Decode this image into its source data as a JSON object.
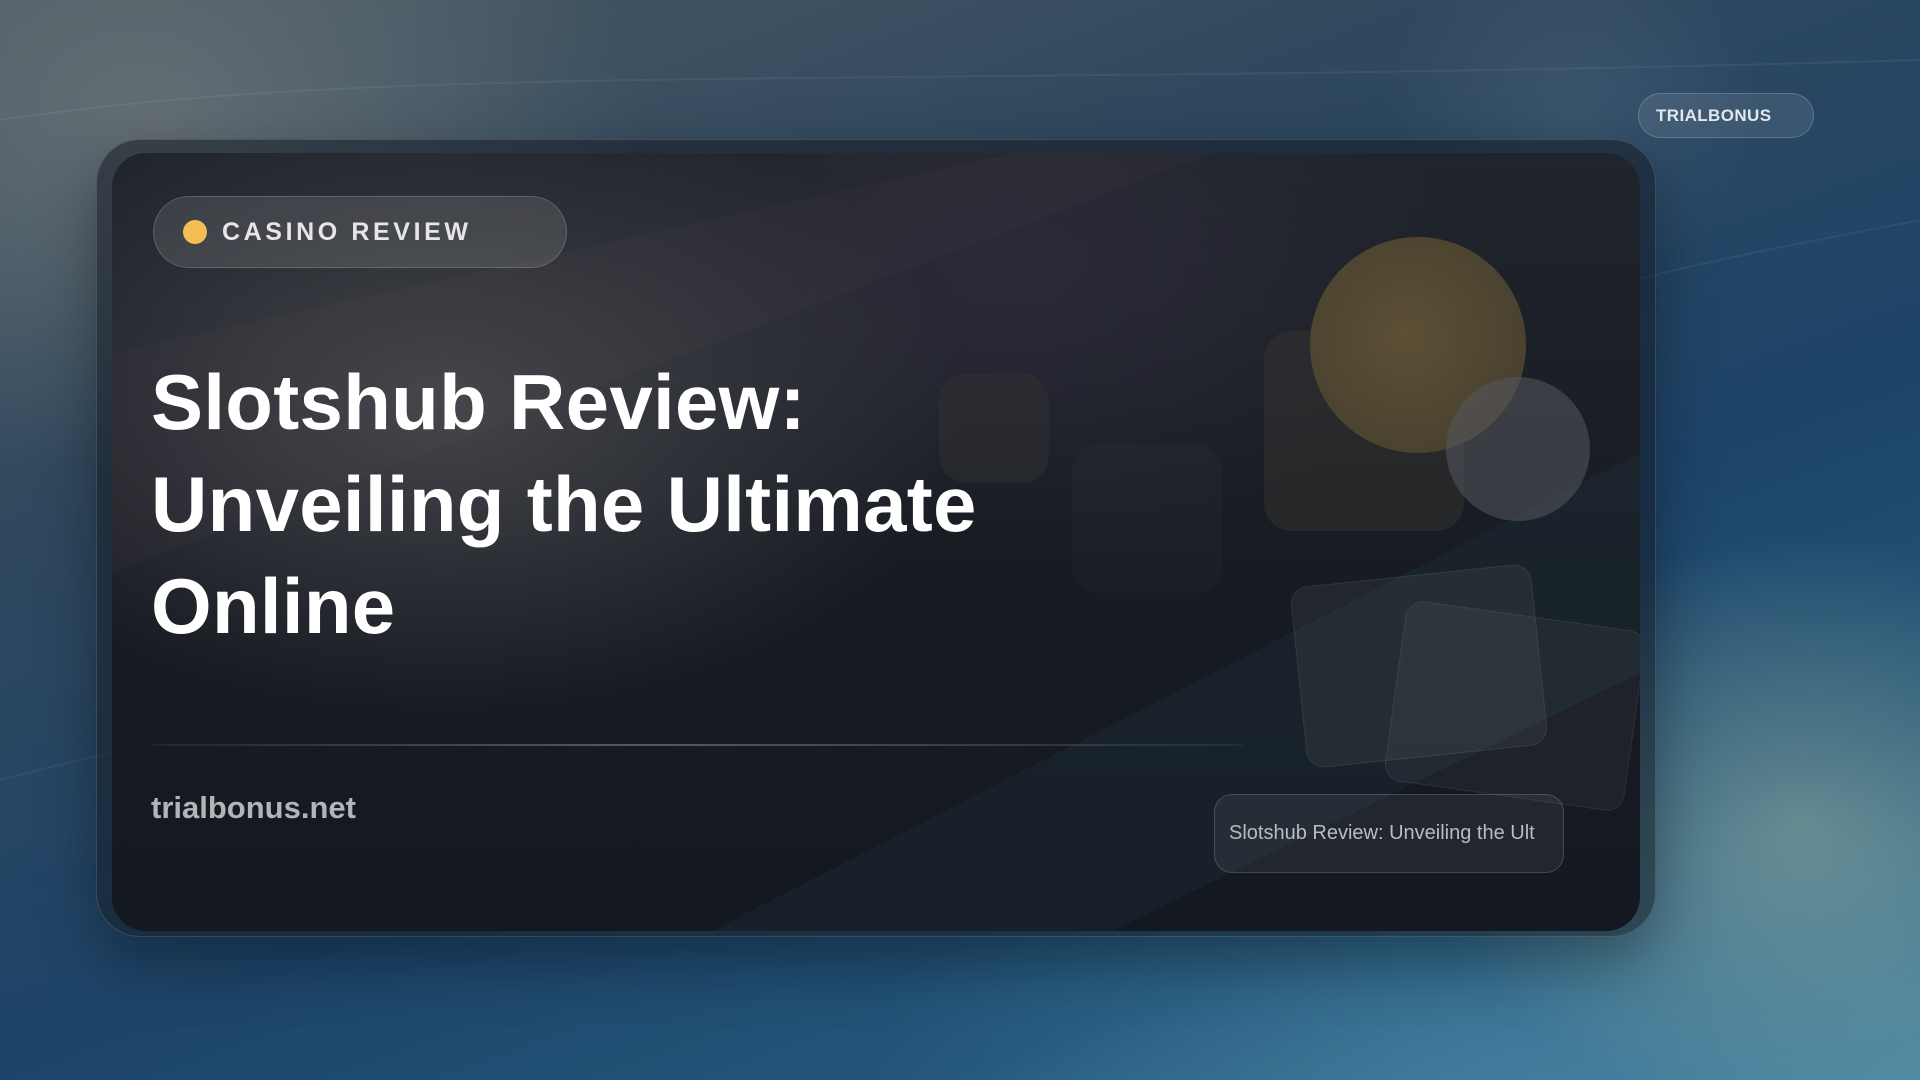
{
  "brand_badge": {
    "label": "TRIALBONUS"
  },
  "card": {
    "category": {
      "label": "CASINO REVIEW",
      "dot_color": "#f3bf54"
    },
    "title_lines": [
      "Slotshub Review:",
      "Unveiling the Ultimate",
      "Online"
    ],
    "domain": "trialbonus.net",
    "caption": "Slotshub Review: Unveiling the Ult"
  },
  "colors": {
    "accent_gold": "#f3bf54",
    "card_background": "#171b22",
    "page_background": "#1d4469"
  }
}
